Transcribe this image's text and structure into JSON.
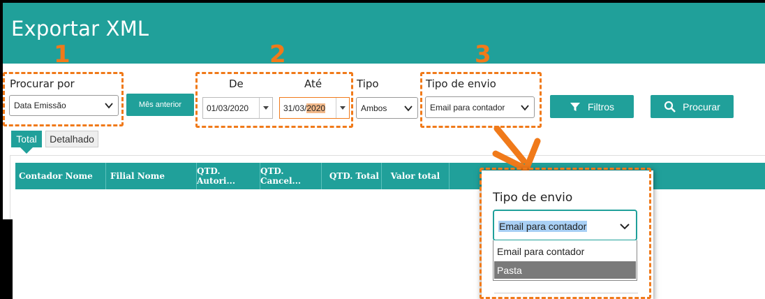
{
  "window": {
    "title": "Exportar XML"
  },
  "annotations": {
    "n1": "1",
    "n2": "2",
    "n3": "3"
  },
  "procurar": {
    "label": "Procurar por",
    "value": "Data Emissão"
  },
  "mes_anterior": {
    "label": "Mês anterior"
  },
  "de": {
    "label": "De",
    "value": "01/03/2020"
  },
  "ate": {
    "label": "Até",
    "value_prefix": "31/03/",
    "value_highlight": "2020"
  },
  "tipo": {
    "label": "Tipo",
    "value": "Ambos"
  },
  "tipo_envio": {
    "label": "Tipo de envio",
    "value": "Email para contador"
  },
  "filtros": {
    "label": "Filtros",
    "icon": "filter-icon"
  },
  "procurar_btn": {
    "label": "Procurar",
    "icon": "search-icon"
  },
  "tabs": [
    {
      "label": "Total",
      "active": true
    },
    {
      "label": "Detalhado",
      "active": false
    }
  ],
  "grid": {
    "columns": [
      "Contador Nome",
      "Filial Nome",
      "QTD. Autori...",
      "QTD. Cancel...",
      "QTD. Total",
      "Valor total"
    ]
  },
  "popup": {
    "label": "Tipo de envio",
    "selected": "Email para contador",
    "options": [
      "Email para contador",
      "Pasta"
    ]
  },
  "colors": {
    "accent": "#20a09a",
    "annotation": "#f07a1a"
  }
}
